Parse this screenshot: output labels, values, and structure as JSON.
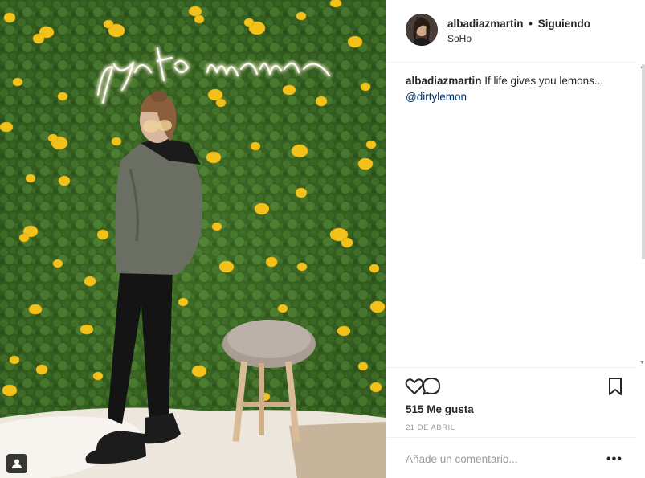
{
  "post": {
    "neon_sign_text": "yes to more",
    "user_tag_icon": "user-tag-icon"
  },
  "header": {
    "username": "albadiazmartin",
    "separator": "•",
    "follow_status": "Siguiendo",
    "location": "SoHo",
    "avatar_icon": "profile-avatar"
  },
  "caption": {
    "username": "albadiazmartin",
    "text": "If life gives you lemons...",
    "mention": "@dirtylemon"
  },
  "actions": {
    "like_icon": "heart-icon",
    "comment_icon": "comment-icon",
    "save_icon": "bookmark-icon",
    "likes_count": "515 Me gusta",
    "date": "21 DE ABRIL"
  },
  "comment_box": {
    "placeholder": "Añade un comentario...",
    "more_label": "•••"
  },
  "colors": {
    "mention_link": "#003569",
    "secondary_text": "#999999",
    "border": "#efefef",
    "foliage": "#2f5a1e",
    "lemon": "#f2c21b"
  }
}
